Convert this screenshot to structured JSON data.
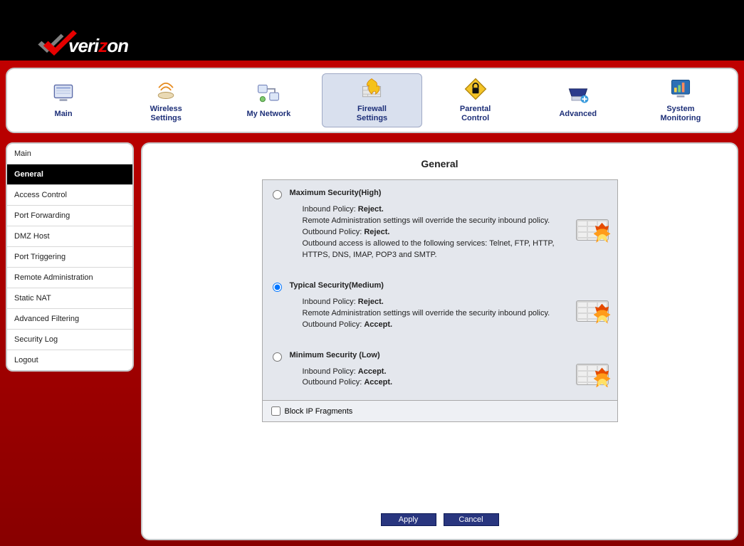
{
  "brand": {
    "name_pre": "veri",
    "name_mid": "z",
    "name_post": "on"
  },
  "topnav": [
    {
      "id": "main",
      "label": "Main",
      "active": false
    },
    {
      "id": "wireless",
      "label": "Wireless\nSettings",
      "active": false
    },
    {
      "id": "mynetwork",
      "label": "My Network",
      "active": false
    },
    {
      "id": "firewall",
      "label": "Firewall\nSettings",
      "active": true
    },
    {
      "id": "parental",
      "label": "Parental\nControl",
      "active": false
    },
    {
      "id": "advanced",
      "label": "Advanced",
      "active": false
    },
    {
      "id": "monitoring",
      "label": "System\nMonitoring",
      "active": false
    }
  ],
  "sidebar": [
    {
      "id": "main",
      "label": "Main",
      "active": false
    },
    {
      "id": "general",
      "label": "General",
      "active": true
    },
    {
      "id": "access",
      "label": "Access Control",
      "active": false
    },
    {
      "id": "portfwd",
      "label": "Port Forwarding",
      "active": false
    },
    {
      "id": "dmz",
      "label": "DMZ Host",
      "active": false
    },
    {
      "id": "porttrig",
      "label": "Port Triggering",
      "active": false
    },
    {
      "id": "remote",
      "label": "Remote Administration",
      "active": false
    },
    {
      "id": "snat",
      "label": "Static NAT",
      "active": false
    },
    {
      "id": "advfilt",
      "label": "Advanced Filtering",
      "active": false
    },
    {
      "id": "seclog",
      "label": "Security Log",
      "active": false
    },
    {
      "id": "logout",
      "label": "Logout",
      "active": false
    }
  ],
  "page": {
    "title": "General",
    "levels": [
      {
        "id": "high",
        "selected": false,
        "title": "Maximum Security(High)",
        "in_label": "Inbound Policy: ",
        "in_value": "Reject.",
        "in_note": "Remote Administration settings will override the security inbound policy.",
        "out_label": "Outbound Policy: ",
        "out_value": "Reject.",
        "out_note": "Outbound access is allowed to the following services: Telnet, FTP, HTTP, HTTPS, DNS, IMAP, POP3 and SMTP."
      },
      {
        "id": "medium",
        "selected": true,
        "title": "Typical Security(Medium)",
        "in_label": "Inbound Policy: ",
        "in_value": "Reject.",
        "in_note": "Remote Administration settings will override the security inbound policy.",
        "out_label": "Outbound Policy: ",
        "out_value": "Accept.",
        "out_note": ""
      },
      {
        "id": "low",
        "selected": false,
        "title": "Minimum Security (Low)",
        "in_label": "Inbound Policy: ",
        "in_value": "Accept.",
        "in_note": "",
        "out_label": "Outbound Policy: ",
        "out_value": "Accept.",
        "out_note": ""
      }
    ],
    "fragments": {
      "checked": false,
      "label": "Block IP Fragments"
    },
    "buttons": {
      "apply": "Apply",
      "cancel": "Cancel"
    }
  },
  "nav_icons": {
    "main": "monitor-icon",
    "wireless": "wireless-icon",
    "mynetwork": "network-icon",
    "firewall": "firewall-icon",
    "parental": "lock-diamond-icon",
    "advanced": "scanner-plus-icon",
    "monitoring": "chart-monitor-icon"
  }
}
